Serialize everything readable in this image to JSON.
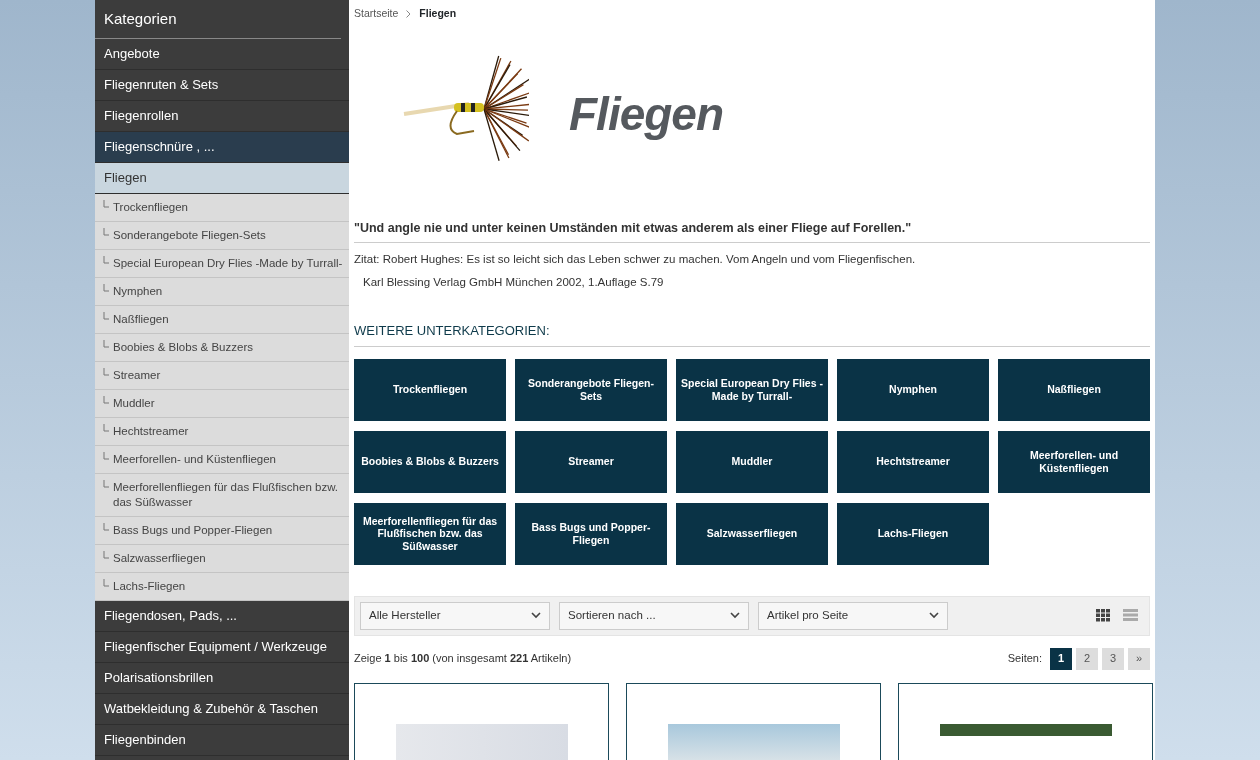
{
  "sidebar": {
    "title": "Kategorien",
    "items": [
      {
        "label": "Angebote",
        "selected": false,
        "hover": false
      },
      {
        "label": "Fliegenruten & Sets",
        "selected": false,
        "hover": false
      },
      {
        "label": "Fliegenrollen",
        "selected": false,
        "hover": false
      },
      {
        "label": "Fliegenschnüre , ...",
        "selected": false,
        "hover": true
      },
      {
        "label": "Fliegen",
        "selected": true,
        "hover": false,
        "children": [
          {
            "label": "Trockenfliegen",
            "selected": false
          },
          {
            "label": "Sonderangebote Fliegen-Sets",
            "selected": false
          },
          {
            "label": "Special European Dry Flies -Made by Turrall-",
            "selected": false
          },
          {
            "label": "Nymphen",
            "selected": false
          },
          {
            "label": "Naßfliegen",
            "selected": false
          },
          {
            "label": "Boobies & Blobs & Buzzers",
            "selected": false
          },
          {
            "label": "Streamer",
            "selected": false
          },
          {
            "label": "Muddler",
            "selected": false
          },
          {
            "label": "Hechtstreamer",
            "selected": false
          },
          {
            "label": "Meerforellen- und Küstenfliegen",
            "selected": false
          },
          {
            "label": "Meerforellenfliegen für das Flußfischen bzw. das Süßwasser",
            "selected": false
          },
          {
            "label": "Bass Bugs und Popper-Fliegen",
            "selected": false
          },
          {
            "label": "Salzwasserfliegen",
            "selected": false
          },
          {
            "label": "Lachs-Fliegen",
            "selected": false
          }
        ]
      },
      {
        "label": "Fliegendosen, Pads, ...",
        "selected": false,
        "hover": false
      },
      {
        "label": "Fliegenfischer Equipment / Werkzeuge",
        "selected": false,
        "hover": false
      },
      {
        "label": "Polarisationsbrillen",
        "selected": false,
        "hover": false
      },
      {
        "label": "Watbekleidung & Zubehör & Taschen",
        "selected": false,
        "hover": false
      },
      {
        "label": "Fliegenbinden",
        "selected": false,
        "hover": false
      }
    ]
  },
  "breadcrumb": [
    {
      "label": "Startseite",
      "current": false
    },
    {
      "label": "Fliegen",
      "current": true
    }
  ],
  "banner": {
    "title": "Fliegen"
  },
  "quote": "\"Und angle nie und unter keinen Umständen mit etwas anderem als einer Fliege auf Forellen.\"",
  "citation": [
    "Zitat: Robert Hughes: Es ist so leicht sich das Leben schwer zu machen. Vom Angeln und vom Fliegenfischen.",
    "Karl Blessing Verlag GmbH München 2002, 1.Auflage S.79"
  ],
  "subcategories": {
    "heading": "WEITERE UNTERKATEGORIEN:",
    "tiles": [
      "Trockenfliegen",
      "Sonderangebote Fliegen-Sets",
      "Special European Dry Flies -Made by Turrall-",
      "Nymphen",
      "Naßfliegen",
      "Boobies & Blobs & Buzzers",
      "Streamer",
      "Muddler",
      "Hechtstreamer",
      "Meerforellen- und Küstenfliegen",
      "Meerforellenfliegen für das Flußfischen bzw. das Süßwasser",
      "Bass Bugs und Popper-Fliegen",
      "Salzwasserfliegen",
      "Lachs-Fliegen"
    ]
  },
  "filters": [
    {
      "value": "Alle Hersteller"
    },
    {
      "value": "Sortieren nach ..."
    },
    {
      "value": "Artikel pro Seite"
    }
  ],
  "view_modes": [
    {
      "kind": "grid",
      "selected": true
    },
    {
      "kind": "list",
      "selected": false
    }
  ],
  "result_summary": "Zeige **1** bis **100** (von insgesamt **221** Artikeln)",
  "pagination": {
    "label": "Seiten:",
    "pages": [
      {
        "label": "1",
        "selected": true
      },
      {
        "label": "2",
        "selected": false
      },
      {
        "label": "3",
        "selected": false
      },
      {
        "label": "»",
        "selected": false
      }
    ]
  }
}
